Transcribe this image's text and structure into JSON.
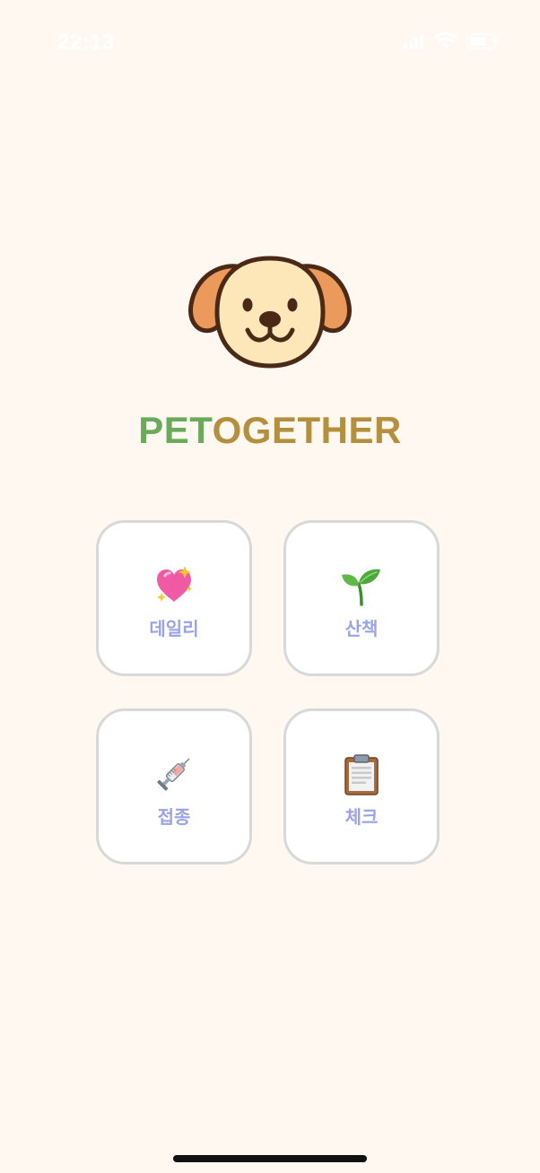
{
  "status_bar": {
    "time": "22:13",
    "icons": [
      "signal-icon",
      "wifi-icon",
      "battery-icon"
    ]
  },
  "app": {
    "logo_icon": "dog-face-icon",
    "brand_part1": "PET",
    "brand_part2": "OGETHER",
    "colors": {
      "background": "#fff8f1",
      "brand_green": "#6aab5b",
      "brand_gold": "#b48f3e",
      "card_label": "#9aa3e6",
      "card_border": "#d8d8d8"
    }
  },
  "menu": {
    "items": [
      {
        "label": "데일리",
        "icon": "sparkling-heart-icon"
      },
      {
        "label": "산책",
        "icon": "seedling-icon"
      },
      {
        "label": "접종",
        "icon": "syringe-icon"
      },
      {
        "label": "체크",
        "icon": "clipboard-icon"
      }
    ]
  }
}
